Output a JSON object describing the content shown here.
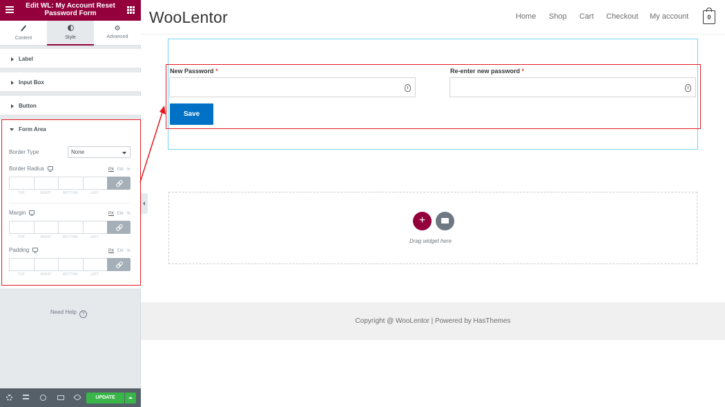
{
  "editor": {
    "title": "Edit WL: My Account Reset Password Form",
    "tabs": [
      {
        "label": "Content"
      },
      {
        "label": "Style"
      },
      {
        "label": "Advanced"
      }
    ],
    "sections": {
      "label": "Label",
      "input_box": "Input Box",
      "button": "Button",
      "form_area": "Form Area"
    },
    "form_area": {
      "border_type_label": "Border Type",
      "border_type_value": "None",
      "border_radius_label": "Border Radius",
      "margin_label": "Margin",
      "padding_label": "Padding",
      "units": [
        "PX",
        "EM",
        "%"
      ],
      "dimension_labels": [
        "TOP",
        "RIGHT",
        "BOTTOM",
        "LEFT"
      ]
    },
    "need_help": "Need Help",
    "update_label": "UPDATE",
    "accent_color": "#93003c",
    "update_color": "#39b54a"
  },
  "preview": {
    "logo": "WooLentor",
    "nav": [
      "Home",
      "Shop",
      "Cart",
      "Checkout",
      "My account"
    ],
    "cart_count": "0",
    "form": {
      "new_password_label": "New Password",
      "reenter_label": "Re-enter new password",
      "required_mark": "*",
      "save_label": "Save",
      "save_color": "#0071c5"
    },
    "drop_zone_text": "Drag widget here",
    "footer_text": "Copyright @ WooLentor | Powered by HasThemes",
    "highlight_color": "#e4191e"
  }
}
